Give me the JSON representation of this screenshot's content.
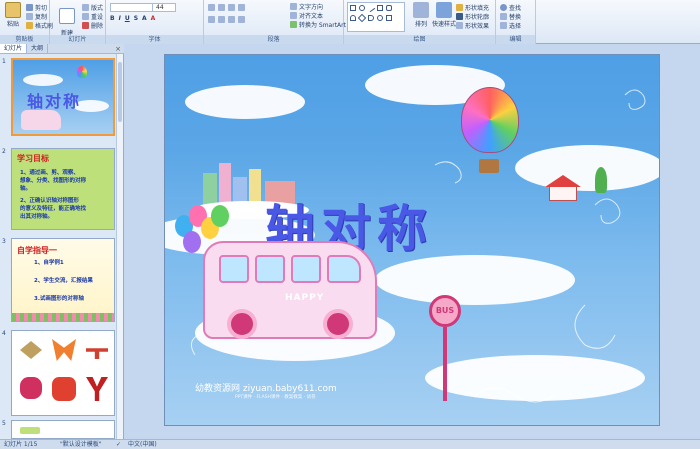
{
  "ribbon": {
    "clipboard": {
      "paste": "粘贴",
      "cut": "剪切",
      "copy": "复制",
      "format": "格式刷",
      "title": "剪贴板"
    },
    "slides": {
      "new_slide": "新建\n幻灯片",
      "layout": "版式",
      "reset": "重设",
      "delete": "删除",
      "title": "幻灯片"
    },
    "font": {
      "size": "44",
      "title": "字体"
    },
    "paragraph": {
      "text_direction": "文字方向",
      "align_text": "对齐文本",
      "smartart": "转换为 SmartArt",
      "title": "段落"
    },
    "drawing": {
      "arrange": "排列",
      "quick_styles": "快速样式",
      "shape_fill": "形状填充",
      "shape_outline": "形状轮廓",
      "shape_effects": "形状效果",
      "title": "绘图"
    },
    "editing": {
      "find": "查找",
      "replace": "替换",
      "select": "选择",
      "title": "编辑"
    }
  },
  "panel": {
    "tabs": [
      "幻灯片",
      "大纲"
    ],
    "close": "×",
    "slides": [
      {
        "num": "1",
        "title": "轴对称"
      },
      {
        "num": "2",
        "heading": "学习目标",
        "lines": [
          "1、通过画、剪、观察、",
          "想象、分类、找图形的对称",
          "轴。",
          "2、正确认识轴对称图形",
          "的意义及特征，能正确地找",
          "出其对称轴。"
        ]
      },
      {
        "num": "3",
        "heading": "自学指导一",
        "lines": [
          "1、自学例1",
          "2、学生交流，汇报结果",
          "3.试画图形的对称轴"
        ]
      },
      {
        "num": "4"
      },
      {
        "num": "5"
      }
    ]
  },
  "slide": {
    "title": "轴对称",
    "bus_text": "HAPPY",
    "sign_text": "BUS",
    "footer": "幼教资源网 ziyuan.baby611.com",
    "footer_sub": "PPT课件 · FLASH课件 · 教案教案 · 试卷"
  },
  "status": {
    "slide_pos": "幻灯片 1/15",
    "theme": "\"默认设计模板\"",
    "language": "中文(中国)"
  },
  "colors": {
    "title": "#4a58e6",
    "selected_border": "#f29a3a",
    "sky": "#5aa6e6"
  }
}
